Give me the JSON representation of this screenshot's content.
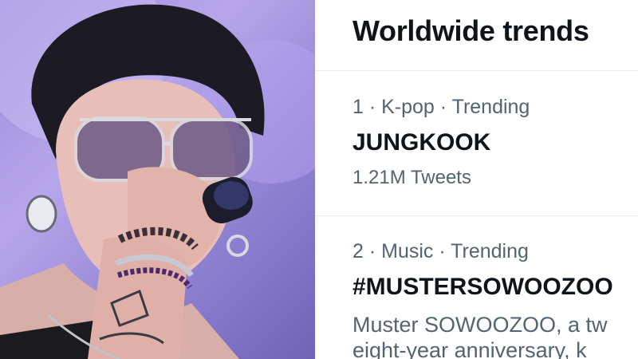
{
  "header": {
    "title": "Worldwide trends"
  },
  "trends": [
    {
      "meta": "1 · K-pop · Trending",
      "name": "JUNGKOOK",
      "count": "1.21M Tweets"
    },
    {
      "meta": "2 · Music · Trending",
      "name": "#MUSTERSOWOOZOO",
      "description_line1": "Muster SOWOOZOO, a tw",
      "description_line2": "eight-year anniversary, k"
    }
  ],
  "colors": {
    "primary_text": "#0f1419",
    "secondary_text": "#536471",
    "divider": "#e6ecf0",
    "photo_background": "#9a8ad9"
  }
}
